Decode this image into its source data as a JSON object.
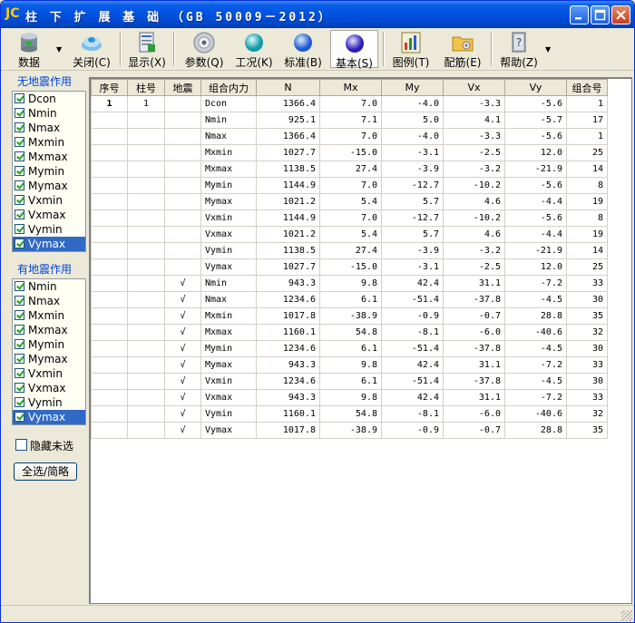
{
  "window": {
    "logo": "JC",
    "title": "柱 下 扩 展 基 础 （GB 50009－2012）"
  },
  "toolbar": {
    "items": [
      {
        "label": "数据",
        "icon": "database-icon"
      },
      {
        "label": "关闭(C)",
        "icon": "close-disk-icon"
      },
      {
        "label": "显示(X)",
        "icon": "document-icon"
      },
      {
        "label": "参数(Q)",
        "icon": "disc-icon"
      },
      {
        "label": "工况(K)",
        "icon": "cyan-sphere-icon"
      },
      {
        "label": "标准(B)",
        "icon": "blue-sphere-icon"
      },
      {
        "label": "基本(S)",
        "icon": "purple-sphere-icon"
      },
      {
        "label": "图例(T)",
        "icon": "chart-icon"
      },
      {
        "label": "配筋(E)",
        "icon": "folder-icon"
      },
      {
        "label": "帮助(Z)",
        "icon": "help-book-icon"
      }
    ]
  },
  "panel": {
    "group1_title": "无地震作用",
    "group1_items": [
      "Dcon",
      "Nmin",
      "Nmax",
      "Mxmin",
      "Mxmax",
      "Mymin",
      "Mymax",
      "Vxmin",
      "Vxmax",
      "Vymin",
      "Vymax"
    ],
    "group2_title": "有地震作用",
    "group2_items": [
      "Nmin",
      "Nmax",
      "Mxmin",
      "Mxmax",
      "Mymin",
      "Mymax",
      "Vxmin",
      "Vxmax",
      "Vymin",
      "Vymax"
    ],
    "hide_label": "隐藏未选",
    "select_all_label": "全选/简略"
  },
  "table": {
    "headers": [
      "序号",
      "柱号",
      "地震",
      "组合内力",
      "N",
      "Mx",
      "My",
      "Vx",
      "Vy",
      "组合号"
    ],
    "rows": [
      [
        "1",
        "1",
        "",
        "Dcon",
        "1366.4",
        "7.0",
        "-4.0",
        "-3.3",
        "-5.6",
        "1"
      ],
      [
        "",
        "",
        "",
        "Nmin",
        "925.1",
        "7.1",
        "5.0",
        "4.1",
        "-5.7",
        "17"
      ],
      [
        "",
        "",
        "",
        "Nmax",
        "1366.4",
        "7.0",
        "-4.0",
        "-3.3",
        "-5.6",
        "1"
      ],
      [
        "",
        "",
        "",
        "Mxmin",
        "1027.7",
        "-15.0",
        "-3.1",
        "-2.5",
        "12.0",
        "25"
      ],
      [
        "",
        "",
        "",
        "Mxmax",
        "1138.5",
        "27.4",
        "-3.9",
        "-3.2",
        "-21.9",
        "14"
      ],
      [
        "",
        "",
        "",
        "Mymin",
        "1144.9",
        "7.0",
        "-12.7",
        "-10.2",
        "-5.6",
        "8"
      ],
      [
        "",
        "",
        "",
        "Mymax",
        "1021.2",
        "5.4",
        "5.7",
        "4.6",
        "-4.4",
        "19"
      ],
      [
        "",
        "",
        "",
        "Vxmin",
        "1144.9",
        "7.0",
        "-12.7",
        "-10.2",
        "-5.6",
        "8"
      ],
      [
        "",
        "",
        "",
        "Vxmax",
        "1021.2",
        "5.4",
        "5.7",
        "4.6",
        "-4.4",
        "19"
      ],
      [
        "",
        "",
        "",
        "Vymin",
        "1138.5",
        "27.4",
        "-3.9",
        "-3.2",
        "-21.9",
        "14"
      ],
      [
        "",
        "",
        "",
        "Vymax",
        "1027.7",
        "-15.0",
        "-3.1",
        "-2.5",
        "12.0",
        "25"
      ],
      [
        "",
        "",
        "√",
        "Nmin",
        "943.3",
        "9.8",
        "42.4",
        "31.1",
        "-7.2",
        "33"
      ],
      [
        "",
        "",
        "√",
        "Nmax",
        "1234.6",
        "6.1",
        "-51.4",
        "-37.8",
        "-4.5",
        "30"
      ],
      [
        "",
        "",
        "√",
        "Mxmin",
        "1017.8",
        "-38.9",
        "-0.9",
        "-0.7",
        "28.8",
        "35"
      ],
      [
        "",
        "",
        "√",
        "Mxmax",
        "1160.1",
        "54.8",
        "-8.1",
        "-6.0",
        "-40.6",
        "32"
      ],
      [
        "",
        "",
        "√",
        "Mymin",
        "1234.6",
        "6.1",
        "-51.4",
        "-37.8",
        "-4.5",
        "30"
      ],
      [
        "",
        "",
        "√",
        "Mymax",
        "943.3",
        "9.8",
        "42.4",
        "31.1",
        "-7.2",
        "33"
      ],
      [
        "",
        "",
        "√",
        "Vxmin",
        "1234.6",
        "6.1",
        "-51.4",
        "-37.8",
        "-4.5",
        "30"
      ],
      [
        "",
        "",
        "√",
        "Vxmax",
        "943.3",
        "9.8",
        "42.4",
        "31.1",
        "-7.2",
        "33"
      ],
      [
        "",
        "",
        "√",
        "Vymin",
        "1160.1",
        "54.8",
        "-8.1",
        "-6.0",
        "-40.6",
        "32"
      ],
      [
        "",
        "",
        "√",
        "Vymax",
        "1017.8",
        "-38.9",
        "-0.9",
        "-0.7",
        "28.8",
        "35"
      ]
    ]
  }
}
